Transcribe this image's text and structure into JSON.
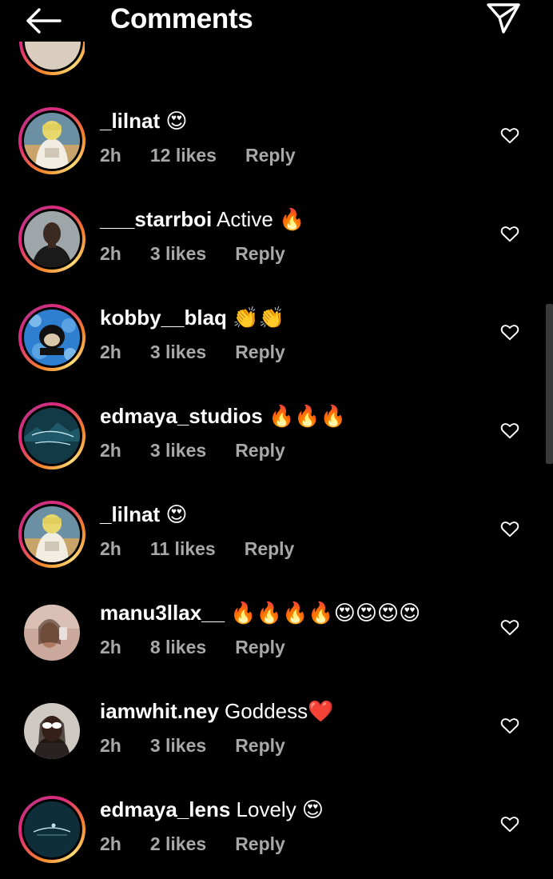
{
  "header": {
    "title": "Comments"
  },
  "colors": {
    "background": "#000000",
    "text": "#ffffff",
    "meta_text": "#a8a8a8",
    "story_ring_start": "#f58529",
    "story_ring_end": "#dd2a7b"
  },
  "icons": {
    "back": "arrow-left-icon",
    "send": "paper-plane-icon",
    "like": "heart-outline-icon"
  },
  "comments": [
    {
      "username": "_lilnat",
      "text": " 😍",
      "time": "2h",
      "likes": "12 likes",
      "reply": "Reply",
      "story_ring": true,
      "avatar": "lilnat"
    },
    {
      "username": "___starrboi",
      "text": " Active 🔥",
      "time": "2h",
      "likes": "3 likes",
      "reply": "Reply",
      "story_ring": true,
      "avatar": "starrboi"
    },
    {
      "username": "kobby__blaq",
      "text": " 👏👏",
      "time": "2h",
      "likes": "3 likes",
      "reply": "Reply",
      "story_ring": true,
      "avatar": "bape"
    },
    {
      "username": "edmaya_studios",
      "text": " 🔥🔥🔥",
      "time": "2h",
      "likes": "3 likes",
      "reply": "Reply",
      "story_ring": true,
      "avatar": "edmaya-studios"
    },
    {
      "username": "_lilnat",
      "text": " 😍",
      "time": "2h",
      "likes": "11 likes",
      "reply": "Reply",
      "story_ring": true,
      "avatar": "lilnat"
    },
    {
      "username": "manu3llax__",
      "text": " 🔥🔥🔥🔥😍😍😍😍",
      "time": "2h",
      "likes": "8 likes",
      "reply": "Reply",
      "story_ring": false,
      "avatar": "manu"
    },
    {
      "username": "iamwhit.ney",
      "text": " Goddess❤️",
      "time": "2h",
      "likes": "3 likes",
      "reply": "Reply",
      "story_ring": false,
      "avatar": "whitney"
    },
    {
      "username": "edmaya_lens",
      "text": " Lovely 😍",
      "time": "2h",
      "likes": "2 likes",
      "reply": "Reply",
      "story_ring": true,
      "avatar": "edmaya-lens"
    }
  ]
}
